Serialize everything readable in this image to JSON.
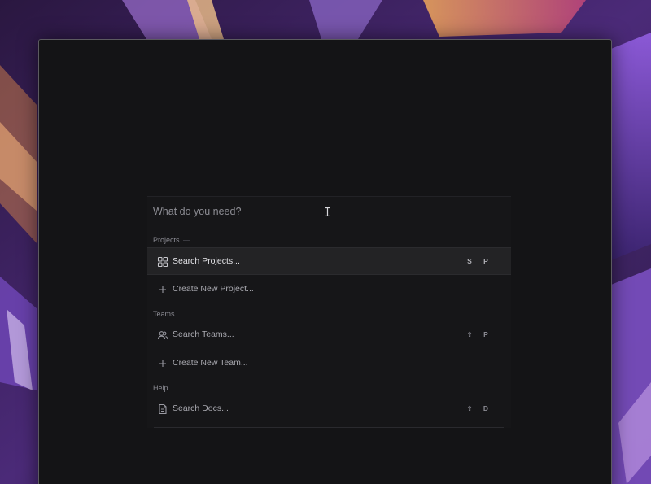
{
  "search": {
    "placeholder": "What do you need?",
    "value": ""
  },
  "sections": {
    "projects": {
      "heading": "Projects",
      "items": [
        {
          "label": "Search Projects...",
          "icon": "grid-icon",
          "shortcut": [
            "S",
            "P"
          ],
          "selected": true
        },
        {
          "label": "Create New Project...",
          "icon": "plus-icon",
          "shortcut": [],
          "selected": false
        }
      ]
    },
    "teams": {
      "heading": "Teams",
      "items": [
        {
          "label": "Search Teams...",
          "icon": "users-icon",
          "shortcut": [
            "⇧",
            "P"
          ],
          "selected": false
        },
        {
          "label": "Create New Team...",
          "icon": "plus-icon",
          "shortcut": [],
          "selected": false
        }
      ]
    },
    "help": {
      "heading": "Help",
      "items": [
        {
          "label": "Search Docs...",
          "icon": "document-icon",
          "shortcut": [
            "⇧",
            "D"
          ],
          "selected": false
        }
      ]
    }
  },
  "colors": {
    "window_background": "#141416",
    "palette_background": "#161618",
    "selected_row": "#232325",
    "wallpaper_accent": "#6a3fa0"
  }
}
